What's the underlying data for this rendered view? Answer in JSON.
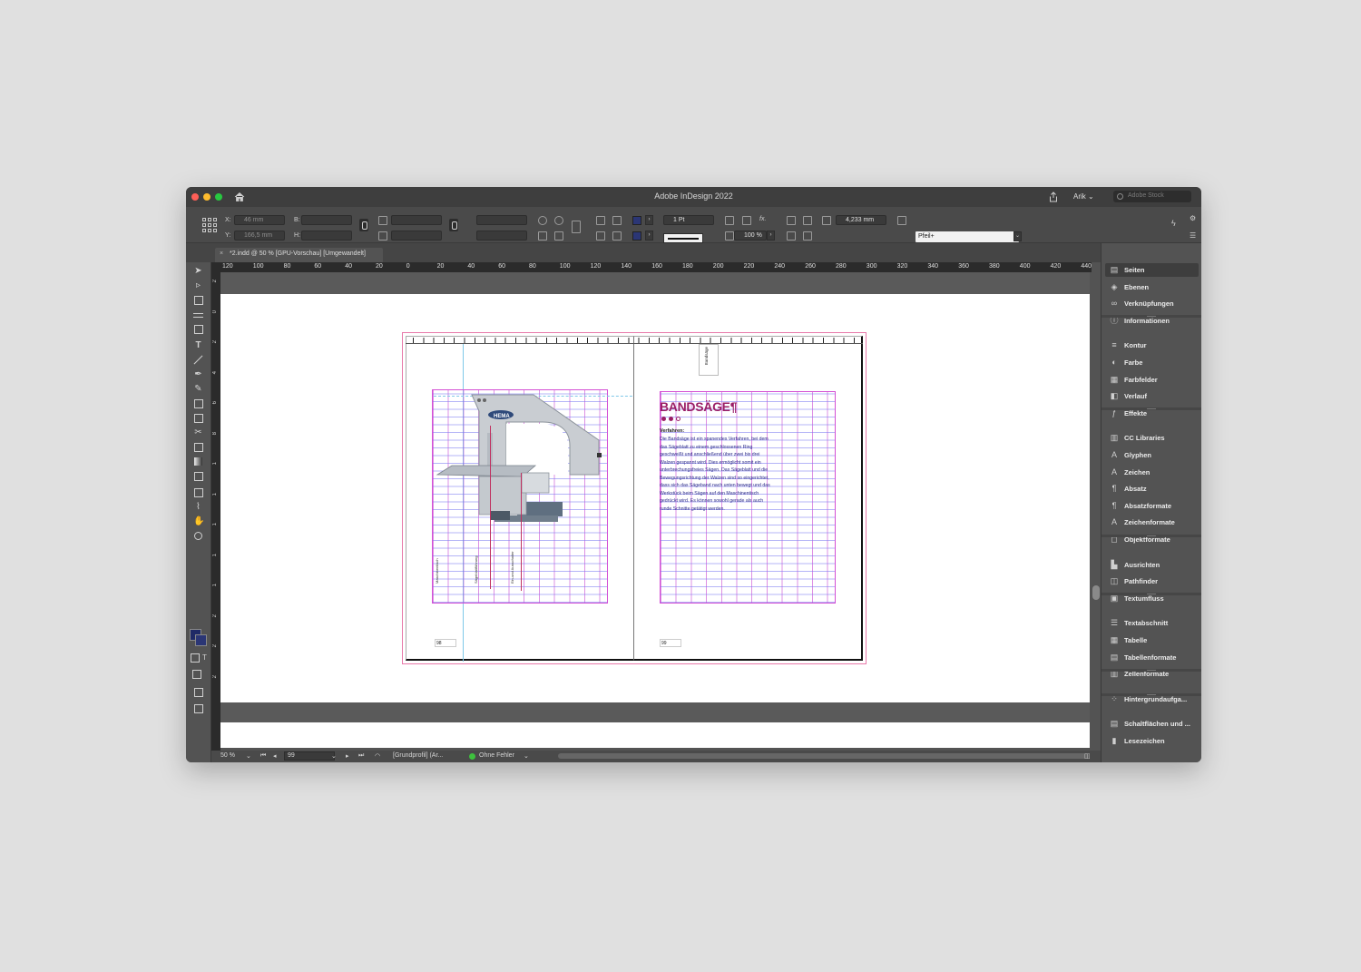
{
  "window": {
    "title": "Adobe InDesign 2022",
    "user": "Arik",
    "stock_search_placeholder": "Adobe Stock"
  },
  "control": {
    "x_label": "X:",
    "x_value": "46 mm",
    "y_label": "Y:",
    "y_value": "166,5 mm",
    "w_label": "B:",
    "h_label": "H:",
    "stroke_weight": "1 Pt",
    "opacity": "100 %",
    "gap": "4,233 mm",
    "object_style": "Pfeil+",
    "fill_color": "#2b3675"
  },
  "tab": {
    "close": "×",
    "title": "*2.indd @ 50 % [GPU-Vorschau] [Umgewandelt]"
  },
  "ruler": {
    "top_labels": [
      "120",
      "100",
      "80",
      "60",
      "40",
      "20",
      "0",
      "20",
      "40",
      "60",
      "80",
      "100",
      "120",
      "140",
      "160",
      "180",
      "200",
      "220",
      "240",
      "260",
      "280",
      "300",
      "320",
      "340",
      "360",
      "380",
      "400",
      "420",
      "440"
    ],
    "left_labels": [
      "2",
      "0",
      "2",
      "4",
      "6",
      "8",
      "1",
      "1",
      "1",
      "1",
      "1",
      "2",
      "2",
      "2"
    ]
  },
  "document": {
    "left_page": {
      "page_number": "98",
      "labels": [
        "Maschinentisch",
        "Sägeblattführung",
        "Ein-und Ausschalter"
      ]
    },
    "right_page": {
      "page_number": "99",
      "side_tab": "Bandsäge",
      "headline": "BANDSÄGE¶",
      "subhead": "Verfahren:",
      "body": "Die Bandsäge ist ein spanendes Verfahren, bei dem das Sägeblatt zu einem geschlossenen Ring geschweißt und anschließend über zwei bis drei Walzen gespannt wird. Dies ermöglicht somit ein unterbrechungsfreies Sägen. Das Sägeblatt und die Bewegungsrichtung der Walzen sind so eingerichtet, dass sich das Sägeband nach unten bewegt und das Werkstück beim Sägen auf den Maschinentisch gedrückt wird. Es können sowohl gerade als auch runde Schnitte getätigt werden."
    },
    "accent_color": "#9a1e66"
  },
  "status": {
    "zoom": "50 %",
    "page": "99",
    "profile": "[Grundprofil] (Ar...",
    "preflight": "Ohne Fehler"
  },
  "panels": [
    {
      "label": "Seiten",
      "icon": "pages-icon",
      "glyph": "▤",
      "active": true
    },
    {
      "label": "Ebenen",
      "icon": "layers-icon",
      "glyph": "◈"
    },
    {
      "label": "Verknüpfungen",
      "icon": "links-icon",
      "glyph": "∞"
    },
    {
      "label": "Informationen",
      "icon": "info-icon",
      "glyph": "ⓘ"
    },
    {
      "label": "Kontur",
      "icon": "stroke-icon",
      "glyph": "≡"
    },
    {
      "label": "Farbe",
      "icon": "color-icon",
      "glyph": "◐"
    },
    {
      "label": "Farbfelder",
      "icon": "swatches-icon",
      "glyph": "▦"
    },
    {
      "label": "Verlauf",
      "icon": "gradient-icon",
      "glyph": "◧"
    },
    {
      "label": "Effekte",
      "icon": "effects-icon",
      "glyph": "ƒ"
    },
    {
      "label": "CC Libraries",
      "icon": "cc-libraries-icon",
      "glyph": "▥"
    },
    {
      "label": "Glyphen",
      "icon": "glyphs-icon",
      "glyph": "A"
    },
    {
      "label": "Zeichen",
      "icon": "character-icon",
      "glyph": "A"
    },
    {
      "label": "Absatz",
      "icon": "paragraph-icon",
      "glyph": "¶"
    },
    {
      "label": "Absatzformate",
      "icon": "paragraph-styles-icon",
      "glyph": "¶"
    },
    {
      "label": "Zeichenformate",
      "icon": "character-styles-icon",
      "glyph": "A"
    },
    {
      "label": "Objektformate",
      "icon": "object-styles-icon",
      "glyph": "◻"
    },
    {
      "label": "Ausrichten",
      "icon": "align-icon",
      "glyph": "▙"
    },
    {
      "label": "Pathfinder",
      "icon": "pathfinder-icon",
      "glyph": "◫"
    },
    {
      "label": "Textumfluss",
      "icon": "text-wrap-icon",
      "glyph": "▣"
    },
    {
      "label": "Textabschnitt",
      "icon": "story-icon",
      "glyph": "☰"
    },
    {
      "label": "Tabelle",
      "icon": "table-icon",
      "glyph": "▦"
    },
    {
      "label": "Tabellenformate",
      "icon": "table-styles-icon",
      "glyph": "▤"
    },
    {
      "label": "Zellenformate",
      "icon": "cell-styles-icon",
      "glyph": "▥"
    },
    {
      "label": "Hintergrundaufga...",
      "icon": "background-tasks-icon",
      "glyph": "⁘"
    },
    {
      "label": "Schaltflächen und ...",
      "icon": "buttons-icon",
      "glyph": "▤"
    },
    {
      "label": "Lesezeichen",
      "icon": "bookmarks-icon",
      "glyph": "▮"
    }
  ]
}
